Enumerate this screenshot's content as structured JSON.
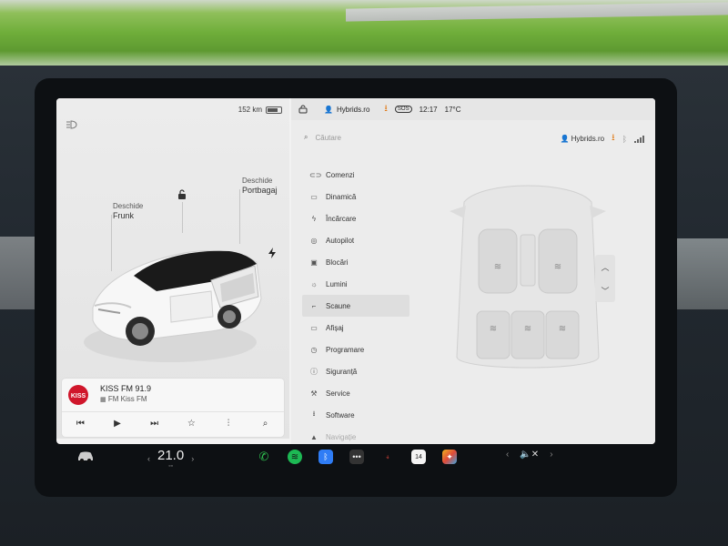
{
  "left": {
    "range": "152 km",
    "frunk_action": "Deschide",
    "frunk_name": "Frunk",
    "trunk_action": "Deschide",
    "trunk_name": "Portbagaj"
  },
  "media": {
    "title": "KISS FM 91.9",
    "subtitle": "FM Kiss FM",
    "logo_text": "KISS"
  },
  "status_bar": {
    "profile": "Hybrids.ro",
    "sos_label": "SOS",
    "time": "12:17",
    "temperature": "17°C"
  },
  "search": {
    "placeholder": "Căutare"
  },
  "header": {
    "profile": "Hybrids.ro"
  },
  "menu": {
    "items": [
      {
        "label": "Comenzi",
        "icon": "toggle-icon"
      },
      {
        "label": "Dinamică",
        "icon": "car-icon"
      },
      {
        "label": "Încărcare",
        "icon": "bolt-icon"
      },
      {
        "label": "Autopilot",
        "icon": "steering-wheel-icon"
      },
      {
        "label": "Blocări",
        "icon": "lock-icon"
      },
      {
        "label": "Lumini",
        "icon": "sun-icon"
      },
      {
        "label": "Scaune",
        "icon": "seat-icon",
        "active": true
      },
      {
        "label": "Afișaj",
        "icon": "display-icon"
      },
      {
        "label": "Programare",
        "icon": "clock-icon"
      },
      {
        "label": "Siguranță",
        "icon": "shield-icon"
      },
      {
        "label": "Service",
        "icon": "wrench-icon"
      },
      {
        "label": "Software",
        "icon": "download-icon"
      },
      {
        "label": "Navigație",
        "icon": "navigation-icon"
      }
    ]
  },
  "bottom_bar": {
    "cabin_temperature": "21.0",
    "calendar_day": "14"
  },
  "colors": {
    "accent_orange": "#e07b1a",
    "phone_green": "#2fbf4f",
    "spotify_green": "#1db954",
    "bluetooth_blue": "#2f7df6",
    "screen_bg": "#ececec"
  }
}
